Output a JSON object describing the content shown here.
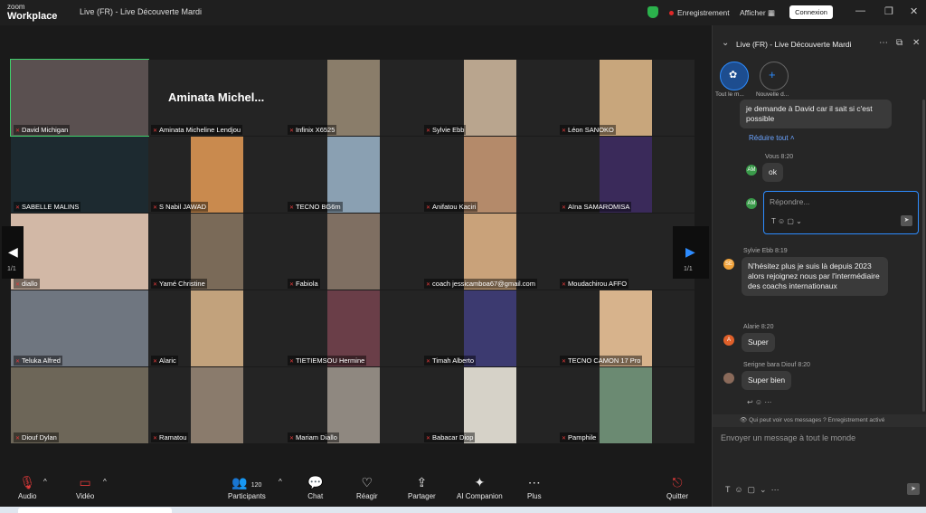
{
  "window": {
    "brand_small": "zoom",
    "brand": "Workplace",
    "title": "Live (FR) - Live Découverte Mardi",
    "recording": "Enregistrement",
    "show": "Afficher",
    "show_icon": "grid-icon",
    "connexion": "Connexion"
  },
  "meeting": {
    "active_speaker_banner": "Aminata  Michel...",
    "page_left": "1/1",
    "page_right": "1/1",
    "tiles": [
      {
        "name": "David Michigan",
        "color": "#5a5050",
        "active": true
      },
      {
        "name": "Aminata Micheline Lendjou",
        "color": "#242424"
      },
      {
        "name": "Infinix X6525",
        "color": "#8a7d6a"
      },
      {
        "name": "Sylvie Ebb",
        "color": "#b9a58e"
      },
      {
        "name": "Léon SANOKO",
        "color": "#c8a67c"
      },
      {
        "name": "SABELLE MALINS",
        "color": "#1d2a30"
      },
      {
        "name": "S Nabil JAWAD",
        "color": "#c98a4e"
      },
      {
        "name": "TECNO BG6m",
        "color": "#8aa0b2"
      },
      {
        "name": "Anifatou Kaciri",
        "color": "#b48a6a"
      },
      {
        "name": "Aïna SAMAROMISA",
        "color": "#3a2a5a"
      },
      {
        "name": "diallo",
        "color": "#d2b8a6"
      },
      {
        "name": "Yamé Christine",
        "color": "#7a6a58"
      },
      {
        "name": "Fabiola",
        "color": "#7f6f62"
      },
      {
        "name": "coach jessicamboa67@gmail.com",
        "color": "#c9a27a"
      },
      {
        "name": "Moudachirou AFFO",
        "color": "#242424"
      },
      {
        "name": "Teluka Alfred",
        "color": "#6f7680"
      },
      {
        "name": "Alaric",
        "color": "#c2a27c"
      },
      {
        "name": "TIETIEMSOU Hermine",
        "color": "#6a3e48"
      },
      {
        "name": "Timah Alberto",
        "color": "#3c3a70"
      },
      {
        "name": "TECNO CAMON 17 Pro",
        "color": "#d7b38c"
      },
      {
        "name": "Diouf Dylan",
        "color": "#6d6658"
      },
      {
        "name": "Ramatou",
        "color": "#8a7b6c"
      },
      {
        "name": "Mariam Diallo",
        "color": "#8f8880"
      },
      {
        "name": "Babacar Diop",
        "color": "#d6d2c8"
      },
      {
        "name": "Pamphile",
        "color": "#6b8a72"
      }
    ]
  },
  "toolbar": {
    "audio": "Audio",
    "video": "Vidéo",
    "participants": "Participants",
    "participants_count": "120",
    "chat": "Chat",
    "reactions": "Réagir",
    "share": "Partager",
    "ai": "AI Companion",
    "more": "Plus",
    "leave": "Quitter"
  },
  "chat": {
    "title": "Live (FR) - Live Découverte Mardi",
    "tab_active": "Tout le m...",
    "tab_new": "Nouvelle d...",
    "msg_partial": "je demande à David car il sait si c'est possible",
    "collapse": "Réduire tout",
    "me_sender": "Vous 8:20",
    "me_text": "ok",
    "me_initials": "AM",
    "reply_placeholder": "Répondre...",
    "m1_sender": "Sylvie Ebb 8:19",
    "m1_initials": "SE",
    "m1_text": "N'hésitez plus je suis là depuis 2023 alors rejoignez nous par l'intermédiaire des coachs internationaux",
    "m2_sender": "Alarie 8:20",
    "m2_initials": "A",
    "m2_text": "Super",
    "m3_sender": "Serigne bara Diouf 8:20",
    "m3_text": "Super bien",
    "notice": "Qui peut voir vos messages ? Enregistrement activé",
    "compose_placeholder": "Envoyer un message à tout le monde"
  }
}
